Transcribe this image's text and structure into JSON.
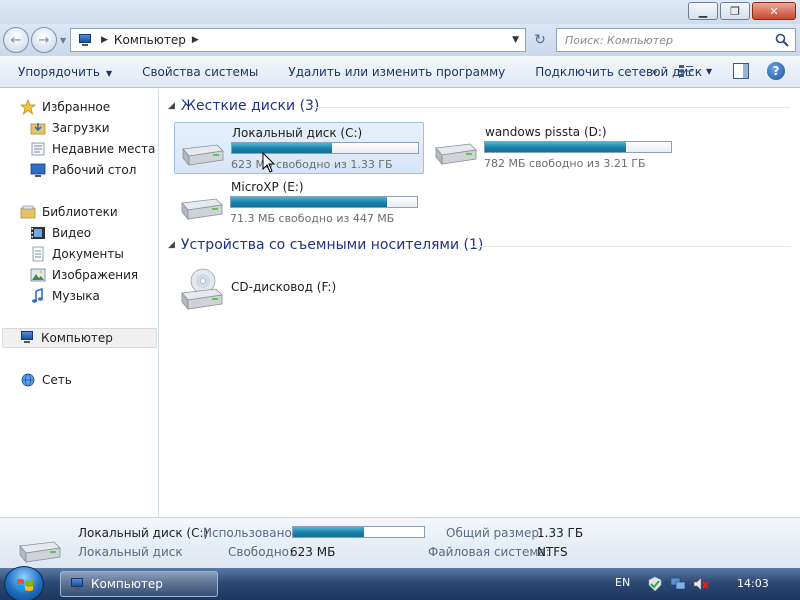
{
  "window": {
    "minimize_glyph": "▁",
    "maximize_glyph": "❐",
    "close_glyph": "✕"
  },
  "navbar": {
    "back_glyph": "←",
    "forward_glyph": "→",
    "address_path": "Компьютер",
    "refresh_glyph": "↻",
    "search_placeholder": "Поиск: Компьютер"
  },
  "command_bar": {
    "items": [
      {
        "label": "Упорядочить",
        "has_dropdown": true
      },
      {
        "label": "Свойства системы"
      },
      {
        "label": "Удалить или изменить программу"
      },
      {
        "label": "Подключить сетевой диск"
      }
    ],
    "more_glyph": "»",
    "help_glyph": "?"
  },
  "nav_pane": {
    "favorites": {
      "label": "Избранное",
      "items": [
        "Загрузки",
        "Недавние места",
        "Рабочий стол"
      ]
    },
    "libraries": {
      "label": "Библиотеки",
      "items": [
        "Видео",
        "Документы",
        "Изображения",
        "Музыка"
      ]
    },
    "computer": {
      "label": "Компьютер",
      "selected": true
    },
    "network": {
      "label": "Сеть"
    }
  },
  "content": {
    "hard_disks_header": "Жесткие диски (3)",
    "removable_header": "Устройства со съемными носителями (1)",
    "drives": [
      {
        "name": "Локальный диск (C:)",
        "free_text": "623 МБ свободно из 1.33 ГБ",
        "used_fraction": 0.54,
        "selected": true
      },
      {
        "name": "wandows pissta (D:)",
        "free_text": "782 МБ свободно из 3.21 ГБ",
        "used_fraction": 0.76
      },
      {
        "name": "MicroXP (E:)",
        "free_text": "71.3 МБ свободно из 447 МБ",
        "used_fraction": 0.84
      }
    ],
    "cd_drive": {
      "name": "CD-дисковод (F:)"
    }
  },
  "details": {
    "name": "Локальный диск (C:)",
    "type": "Локальный диск",
    "used_label": "Использовано:",
    "used_fraction": 0.54,
    "free_label": "Свободно:",
    "free_value": "623 МБ",
    "total_label": "Общий размер:",
    "total_value": "1.33 ГБ",
    "fs_label": "Файловая система:",
    "fs_value": "NTFS"
  },
  "taskbar": {
    "window_label": "Компьютер",
    "language": "EN",
    "clock": "14:03"
  },
  "colors": {
    "accent": "#1e3287",
    "usage_bar": "#1a7fa8",
    "taskbar": "#2d4a74"
  }
}
